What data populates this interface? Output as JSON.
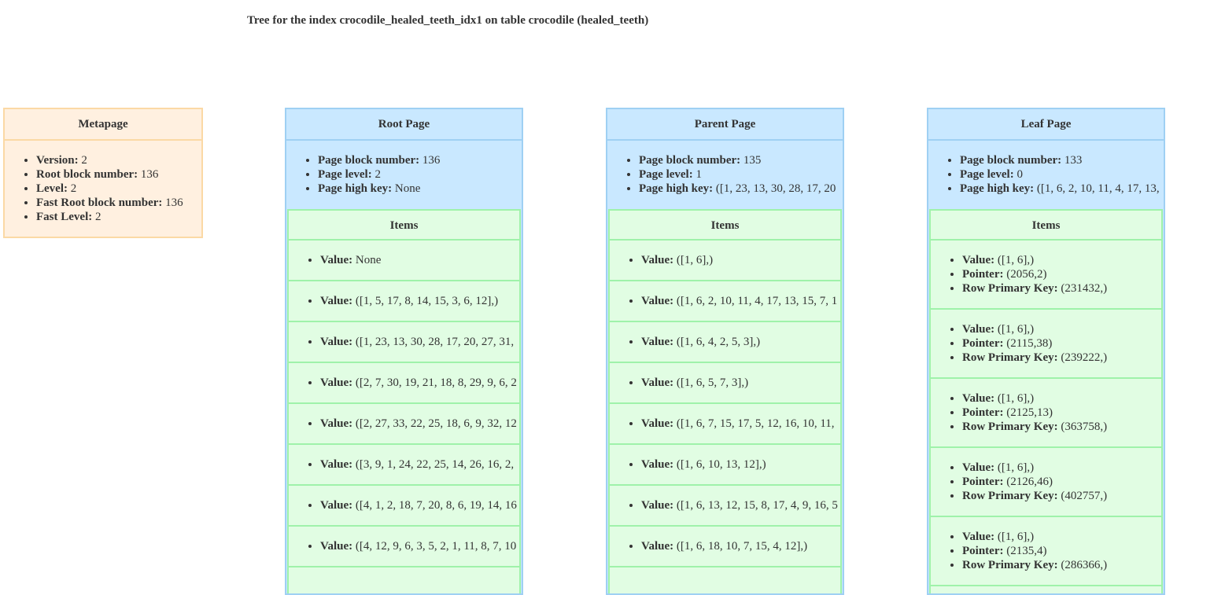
{
  "title": "Tree for the index crocodile_healed_teeth_idx1 on table crocodile (healed_teeth)",
  "labels": {
    "version": "Version:",
    "root_block_number": "Root block number:",
    "level": "Level:",
    "fast_root_block_number": "Fast Root block number:",
    "fast_level": "Fast Level:",
    "page_block_number": "Page block number:",
    "page_level": "Page level:",
    "page_high_key": "Page high key:",
    "value": "Value:",
    "pointer": "Pointer:",
    "row_primary_key": "Row Primary Key:",
    "items": "Items"
  },
  "metapage": {
    "title": "Metapage",
    "version": "2",
    "root_block_number": "136",
    "level": "2",
    "fast_root_block_number": "136",
    "fast_level": "2"
  },
  "root_page": {
    "title": "Root Page",
    "page_block_number": "136",
    "page_level": "2",
    "page_high_key": "None",
    "items": [
      {
        "value": "None"
      },
      {
        "value": "([1, 5, 17, 8, 14, 15, 3, 6, 12],)"
      },
      {
        "value": "([1, 23, 13, 30, 28, 17, 20, 27, 31,"
      },
      {
        "value": "([2, 7, 30, 19, 21, 18, 8, 29, 9, 6, 2"
      },
      {
        "value": "([2, 27, 33, 22, 25, 18, 6, 9, 32, 12"
      },
      {
        "value": "([3, 9, 1, 24, 22, 25, 14, 26, 16, 2,"
      },
      {
        "value": "([4, 1, 2, 18, 7, 20, 8, 6, 19, 14, 16"
      },
      {
        "value": "([4, 12, 9, 6, 3, 5, 2, 1, 11, 8, 7, 10"
      }
    ]
  },
  "parent_page": {
    "title": "Parent Page",
    "page_block_number": "135",
    "page_level": "1",
    "page_high_key": "([1, 23, 13, 30, 28, 17, 20",
    "items": [
      {
        "value": "([1, 6],)"
      },
      {
        "value": "([1, 6, 2, 10, 11, 4, 17, 13, 15, 7, 1"
      },
      {
        "value": "([1, 6, 4, 2, 5, 3],)"
      },
      {
        "value": "([1, 6, 5, 7, 3],)"
      },
      {
        "value": "([1, 6, 7, 15, 17, 5, 12, 16, 10, 11,"
      },
      {
        "value": "([1, 6, 10, 13, 12],)"
      },
      {
        "value": "([1, 6, 13, 12, 15, 8, 17, 4, 9, 16, 5"
      },
      {
        "value": "([1, 6, 18, 10, 7, 15, 4, 12],)"
      }
    ]
  },
  "leaf_page": {
    "title": "Leaf Page",
    "page_block_number": "133",
    "page_level": "0",
    "page_high_key": "([1, 6, 2, 10, 11, 4, 17, 13,",
    "items": [
      {
        "value": "([1, 6],)",
        "pointer": "(2056,2)",
        "row_primary_key": "(231432,)"
      },
      {
        "value": "([1, 6],)",
        "pointer": "(2115,38)",
        "row_primary_key": "(239222,)"
      },
      {
        "value": "([1, 6],)",
        "pointer": "(2125,13)",
        "row_primary_key": "(363758,)"
      },
      {
        "value": "([1, 6],)",
        "pointer": "(2126,46)",
        "row_primary_key": "(402757,)"
      },
      {
        "value": "([1, 6],)",
        "pointer": "(2135,4)",
        "row_primary_key": "(286366,)"
      }
    ]
  }
}
